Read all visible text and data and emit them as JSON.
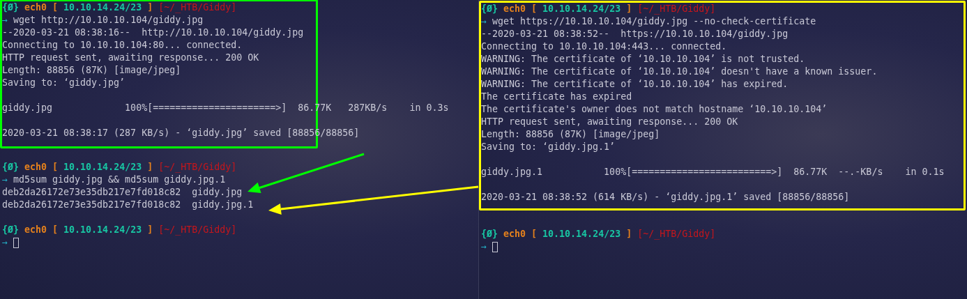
{
  "panes": [
    {
      "blocks": [
        {
          "color": "#00ff00",
          "lines": [
            {
              "kind": "prompt",
              "symbol": "{Ø}",
              "user": "ech0",
              "open": "[",
              "ip": "10.10.14.24/23",
              "close": "]",
              "path": "[~/_HTB/Giddy]"
            },
            {
              "kind": "command",
              "arrow": "→",
              "text": "wget http://10.10.10.104/giddy.jpg"
            },
            {
              "kind": "output",
              "text": "--2020-03-21 08:38:16--  http://10.10.10.104/giddy.jpg"
            },
            {
              "kind": "output",
              "text": "Connecting to 10.10.10.104:80... connected."
            },
            {
              "kind": "output",
              "text": "HTTP request sent, awaiting response... 200 OK"
            },
            {
              "kind": "output",
              "text": "Length: 88856 (87K) [image/jpeg]"
            },
            {
              "kind": "output",
              "text": "Saving to: ‘giddy.jpg’"
            },
            {
              "kind": "blank"
            },
            {
              "kind": "output",
              "text": "giddy.jpg             100%[======================>]  86.77K   287KB/s    in 0.3s"
            },
            {
              "kind": "blank"
            },
            {
              "kind": "output",
              "text": "2020-03-21 08:38:17 (287 KB/s) - ‘giddy.jpg’ saved [88856/88856]"
            }
          ]
        },
        {
          "lines": [
            {
              "kind": "blank"
            },
            {
              "kind": "prompt",
              "symbol": "{Ø}",
              "user": "ech0",
              "open": "[",
              "ip": "10.10.14.24/23",
              "close": "]",
              "path": "[~/_HTB/Giddy]"
            },
            {
              "kind": "command",
              "arrow": "→",
              "text": "md5sum giddy.jpg && md5sum giddy.jpg.1"
            },
            {
              "kind": "output",
              "text": "deb2da26172e73e35db217e7fd018c82  giddy.jpg"
            },
            {
              "kind": "output",
              "text": "deb2da26172e73e35db217e7fd018c82  giddy.jpg.1"
            },
            {
              "kind": "blank"
            },
            {
              "kind": "prompt",
              "symbol": "{Ø}",
              "user": "ech0",
              "open": "[",
              "ip": "10.10.14.24/23",
              "close": "]",
              "path": "[~/_HTB/Giddy]"
            },
            {
              "kind": "cursor",
              "arrow": "→"
            }
          ]
        }
      ]
    },
    {
      "blocks": [
        {
          "color": "#ffff00",
          "lines": [
            {
              "kind": "prompt",
              "symbol": "{Ø}",
              "user": "ech0",
              "open": "[",
              "ip": "10.10.14.24/23",
              "close": "]",
              "path": "[~/_HTB/Giddy]"
            },
            {
              "kind": "command",
              "arrow": "→",
              "text": "wget https://10.10.10.104/giddy.jpg --no-check-certificate"
            },
            {
              "kind": "output",
              "text": "--2020-03-21 08:38:52--  https://10.10.10.104/giddy.jpg"
            },
            {
              "kind": "output",
              "text": "Connecting to 10.10.10.104:443... connected."
            },
            {
              "kind": "output",
              "text": "WARNING: The certificate of ‘10.10.10.104’ is not trusted."
            },
            {
              "kind": "output",
              "text": "WARNING: The certificate of ‘10.10.10.104’ doesn't have a known issuer."
            },
            {
              "kind": "output",
              "text": "WARNING: The certificate of ‘10.10.10.104’ has expired."
            },
            {
              "kind": "output",
              "text": "The certificate has expired"
            },
            {
              "kind": "output",
              "text": "The certificate's owner does not match hostname ‘10.10.10.104’"
            },
            {
              "kind": "output",
              "text": "HTTP request sent, awaiting response... 200 OK"
            },
            {
              "kind": "output",
              "text": "Length: 88856 (87K) [image/jpeg]"
            },
            {
              "kind": "output",
              "text": "Saving to: ‘giddy.jpg.1’"
            },
            {
              "kind": "blank"
            },
            {
              "kind": "output",
              "text": "giddy.jpg.1           100%[=========================>]  86.77K  --.-KB/s    in 0.1s"
            },
            {
              "kind": "blank"
            },
            {
              "kind": "output",
              "text": "2020-03-21 08:38:52 (614 KB/s) - ‘giddy.jpg.1’ saved [88856/88856]"
            }
          ]
        },
        {
          "lines": [
            {
              "kind": "blank"
            },
            {
              "kind": "prompt",
              "symbol": "{Ø}",
              "user": "ech0",
              "open": "[",
              "ip": "10.10.14.24/23",
              "close": "]",
              "path": "[~/_HTB/Giddy]"
            },
            {
              "kind": "cursor",
              "arrow": "→"
            }
          ]
        }
      ]
    }
  ],
  "arrows": [
    {
      "color": "#00ff00"
    },
    {
      "color": "#ffff00"
    }
  ]
}
